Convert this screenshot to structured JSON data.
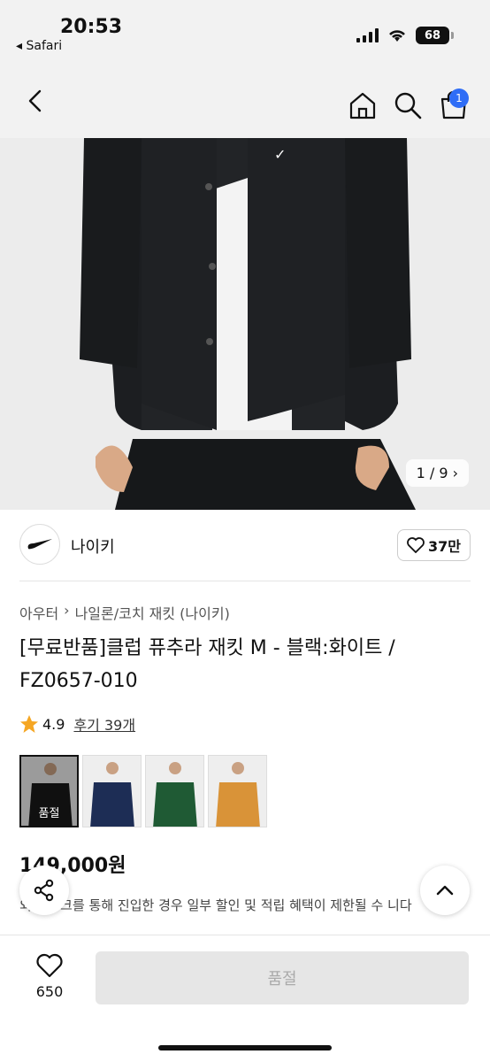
{
  "status_bar": {
    "time": "20:53",
    "back_app": "◂ Safari",
    "battery": "68"
  },
  "nav": {
    "cart_count": "1"
  },
  "gallery": {
    "counter": "1 / 9 ›"
  },
  "brand": {
    "name": "나이키",
    "likes": "37만"
  },
  "breadcrumb": {
    "category": "아우터",
    "separator": "›",
    "subcategory": "나일론/코치 재킷 (나이키)"
  },
  "product": {
    "title": "[무료반품]클럽 퓨추라 재킷 M - 블랙:화이트 / FZ0657-010",
    "rating": "4.9",
    "reviews": "후기 39개",
    "price": "149,000원",
    "notice": "외부 링크를 통해 진입한 경우 일부 할인 및 적립 혜택이 제한될 수 니다"
  },
  "swatches": [
    {
      "color": "#1a1a1a",
      "sold_out_label": "품절"
    },
    {
      "color": "#1d2d55"
    },
    {
      "color": "#1f5a34"
    },
    {
      "color": "#d99338"
    }
  ],
  "bottom_bar": {
    "wish_count": "650",
    "buy_label": "품절"
  },
  "icons": [
    "back-icon",
    "home-icon",
    "search-icon",
    "cart-icon",
    "heart-icon",
    "share-icon",
    "chevron-up-icon",
    "star-icon"
  ]
}
